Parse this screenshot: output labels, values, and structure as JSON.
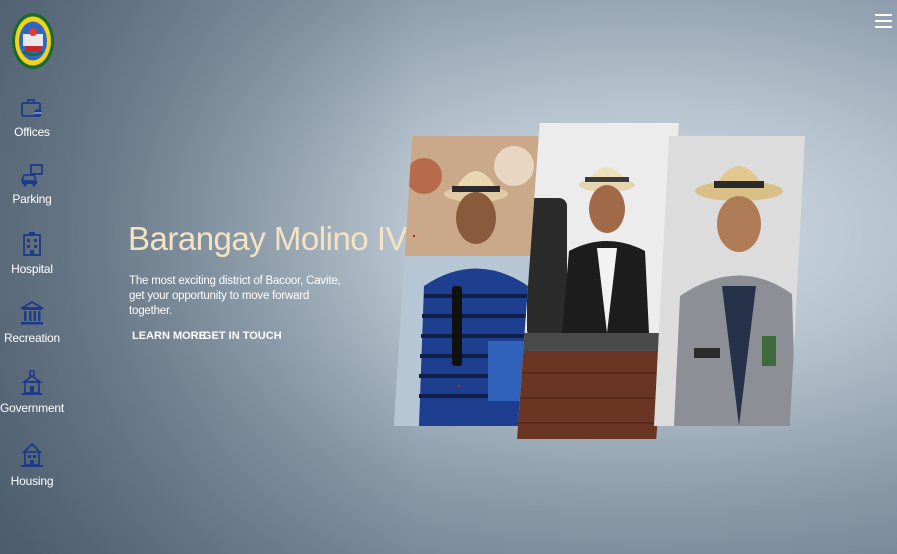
{
  "header": {
    "menu_icon": "hamburger-menu-icon"
  },
  "logo": {
    "text": "BARANGAY MOLINO IV",
    "name": "barangay-seal-logo"
  },
  "sidebar": {
    "items": [
      {
        "label": "Offices",
        "icon": "briefcase-icon"
      },
      {
        "label": "Parking",
        "icon": "car-icon"
      },
      {
        "label": "Hospital",
        "icon": "hospital-building-icon"
      },
      {
        "label": "Recreation",
        "icon": "columns-building-icon"
      },
      {
        "label": "Government",
        "icon": "government-building-icon"
      },
      {
        "label": "Housing",
        "icon": "house-icon"
      }
    ]
  },
  "hero": {
    "title": "Barangay Molino IV",
    "subtitle_line1": "The most exciting district of Bacoor, Cavite,",
    "subtitle_line2": "get your opportunity to move forward together.",
    "learn_more": "LEARN MORE",
    "get_in_touch": "GET IN TOUCH"
  },
  "colors": {
    "title": "#f4e3c2",
    "icon": "#1e3b8a",
    "text": "#ffffff"
  }
}
